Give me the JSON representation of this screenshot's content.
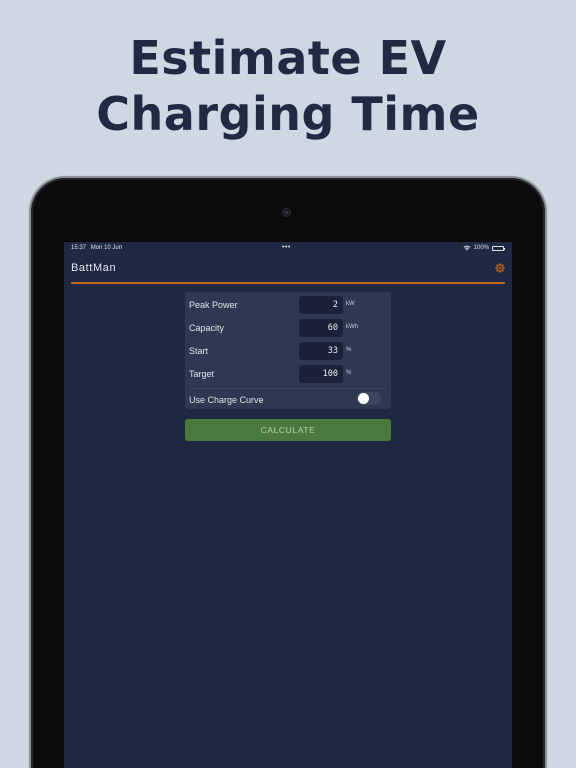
{
  "headline": {
    "line1": "Estimate EV",
    "line2": "Charging Time"
  },
  "status_bar": {
    "time": "15:37",
    "date": "Mon 10 Jun",
    "dots": "•••",
    "battery": "100%"
  },
  "app": {
    "title": "BattMan",
    "settings_icon": "gear-icon",
    "accent_color": "#c6671d"
  },
  "form": {
    "fields": [
      {
        "label": "Peak Power",
        "value": "2",
        "unit": "kW"
      },
      {
        "label": "Capacity",
        "value": "60",
        "unit": "kWh"
      },
      {
        "label": "Start",
        "value": "33",
        "unit": "%"
      },
      {
        "label": "Target",
        "value": "100",
        "unit": "%"
      }
    ],
    "toggle": {
      "label": "Use Charge Curve",
      "on": false
    }
  },
  "calculate": {
    "label": "CALCULATE",
    "color": "#4b7a3e"
  }
}
